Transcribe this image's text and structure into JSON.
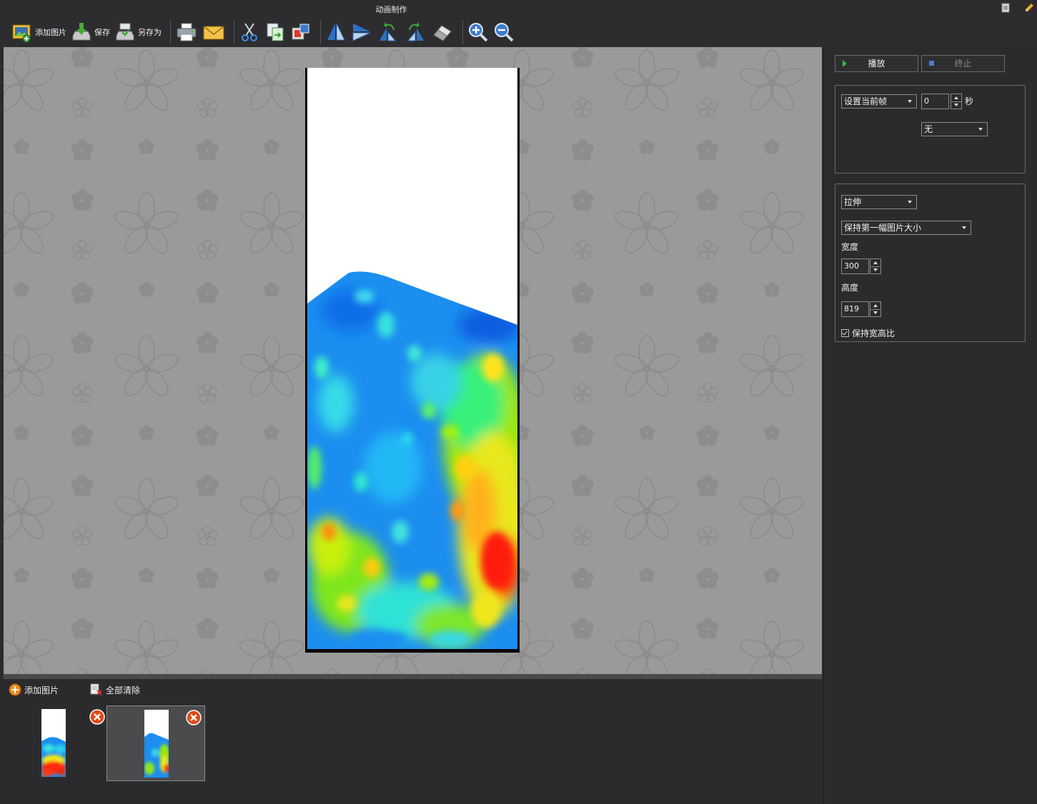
{
  "window": {
    "title": "动画制作"
  },
  "toolbar": {
    "add_image": "添加图片",
    "save": "保存",
    "save_as": "另存为"
  },
  "bottom": {
    "add_image": "添加图片",
    "clear_all": "全部清除",
    "selected_thumbnail": 2
  },
  "panel": {
    "play": "播放",
    "stop": "终止",
    "frame_mode": "设置当前帧",
    "frame_seconds": "0",
    "seconds_unit": "秒",
    "transition": "无",
    "stretch_mode": "拉伸",
    "size_mode": "保持第一幅图片大小",
    "width_label": "宽度",
    "width": "300",
    "height_label": "高度",
    "height": "819",
    "keep_ratio": "保持宽高比",
    "keep_ratio_checked": true
  },
  "colors": {
    "background": "#2b2b2d",
    "canvas": "#9a9a9a",
    "heat_blue": "#1a8cf0",
    "heat_red": "#ff1a0a"
  }
}
